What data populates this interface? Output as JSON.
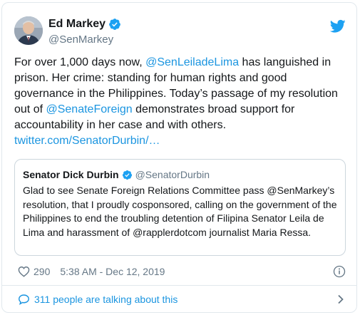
{
  "tweet": {
    "author_name": "Ed Markey",
    "author_handle": "@SenMarkey",
    "text_parts": {
      "p1": "For over 1,000 days now, ",
      "mention1": "@SenLeiladeLima",
      "p2": " has languished in prison. Her crime: standing for human rights and good governance in the Philippines. Today’s passage of my resolution out of ",
      "mention2": "@SenateForeign",
      "p3": " demonstrates broad support for accountability in her case and with others.",
      "link": "twitter.com/SenatorDurbin/…"
    },
    "likes": "290",
    "timestamp": "5:38 AM - Dec 12, 2019"
  },
  "quote": {
    "author_name": "Senator Dick Durbin",
    "author_handle": "@SenatorDurbin",
    "text": "Glad to see Senate Foreign Relations Committee pass @SenMarkey’s resolution, that I proudly cosponsored, calling on the government of the Philippines to end the troubling detention of Filipina Senator Leila de Lima and harassment of @rapplerdotcom journalist Maria Ressa."
  },
  "footer": {
    "talking_label": "311 people are talking about this"
  },
  "colors": {
    "link": "#1b95e0",
    "verified": "#1da1f2",
    "muted": "#657786",
    "border": "#e1e8ed"
  },
  "icons": {
    "verified": "verified-badge-icon",
    "brand": "twitter-bird-icon",
    "like": "heart-icon",
    "info": "info-icon",
    "reply": "speech-bubble-icon",
    "chevron": "chevron-right-icon"
  }
}
